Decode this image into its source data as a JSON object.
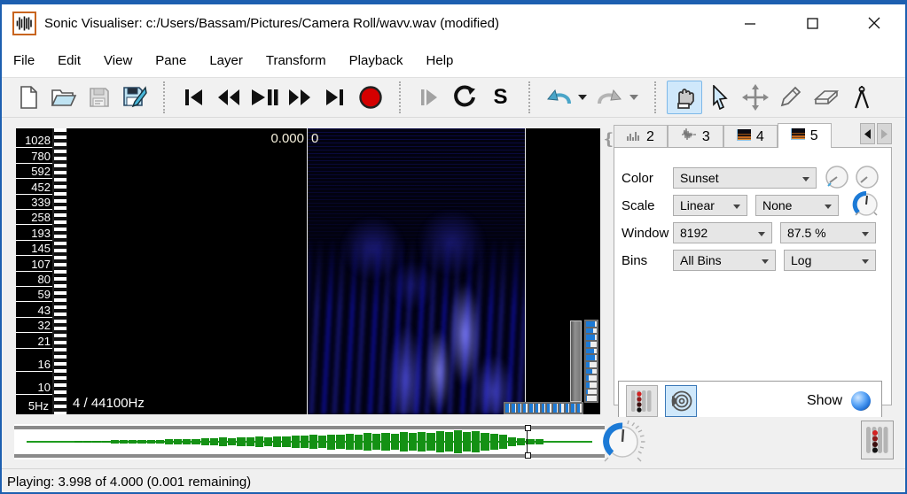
{
  "window": {
    "title": "Sonic Visualiser: c:/Users/Bassam/Pictures/Camera Roll/wavv.wav (modified)",
    "accent_color": "#1d5fb0"
  },
  "menu": {
    "items": [
      "File",
      "Edit",
      "View",
      "Pane",
      "Layer",
      "Transform",
      "Playback",
      "Help"
    ]
  },
  "toolbar": {
    "file_icons": [
      "new-document",
      "open-file",
      "save",
      "save-as"
    ],
    "transport_icons": [
      "skip-to-start",
      "rewind",
      "play-pause",
      "fast-forward",
      "skip-to-end",
      "record"
    ],
    "mode_icons": [
      "play-selection",
      "loop-playback",
      "solo"
    ],
    "solo_label": "S",
    "edit_icons": [
      "undo",
      "redo"
    ],
    "tool_icons": [
      "navigate",
      "select",
      "edit",
      "draw",
      "erase",
      "measure"
    ],
    "selected_tool": "navigate"
  },
  "pane": {
    "freq_labels": [
      "1028",
      "780",
      "592",
      "452",
      "339",
      "258",
      "193",
      "145",
      "107",
      "80",
      "59",
      "43",
      "32",
      "21",
      "16",
      "10"
    ],
    "freq_bottom": "5Hz",
    "time_left": "0.000",
    "time_right": "0",
    "info": "4 / 44100Hz",
    "vwheel_fills": [
      0.85,
      0.7,
      0.8,
      0.45,
      0.75,
      0.85,
      0.35,
      0.6,
      0.25,
      0.3,
      0.15,
      0.1
    ],
    "hwheel_fills": [
      0.9,
      0.85,
      0.8,
      0.55,
      0.75,
      0.65,
      0.8,
      0.55,
      0.75,
      0.45,
      0.65,
      0.85,
      0.5
    ]
  },
  "dock": {
    "tabs": [
      {
        "label": "2",
        "icon": "bar-chart-layer"
      },
      {
        "label": "3",
        "icon": "waveform-layer"
      },
      {
        "label": "4",
        "icon": "spectrogram-layer"
      },
      {
        "label": "5",
        "icon": "spectrogram-layer"
      }
    ],
    "selected_tab": "5",
    "properties": [
      {
        "label": "Color",
        "values": [
          "Sunset"
        ]
      },
      {
        "label": "Scale",
        "values": [
          "Linear",
          "None"
        ]
      },
      {
        "label": "Window",
        "values": [
          "8192",
          "87.5 %"
        ]
      },
      {
        "label": "Bins",
        "values": [
          "All Bins",
          "Log"
        ]
      }
    ],
    "show_label": "Show"
  },
  "overview": {
    "envelope": [
      0.05,
      0.06,
      0.08,
      0.07,
      0.1,
      0.09,
      0.12,
      0.11,
      0.14,
      0.13,
      0.17,
      0.15,
      0.2,
      0.18,
      0.23,
      0.21,
      0.27,
      0.25,
      0.3,
      0.28,
      0.34,
      0.31,
      0.38,
      0.35,
      0.42,
      0.39,
      0.46,
      0.43,
      0.5,
      0.46,
      0.54,
      0.5,
      0.57,
      0.52,
      0.6,
      0.55,
      0.63,
      0.57,
      0.66,
      0.6,
      0.7,
      0.62,
      0.74,
      0.65,
      0.68,
      0.6,
      0.55,
      0.45,
      0.32,
      0.22,
      0.15,
      0.2
    ]
  },
  "status": {
    "text": "Playing: 3.998 of 4.000 (0.001 remaining)"
  }
}
